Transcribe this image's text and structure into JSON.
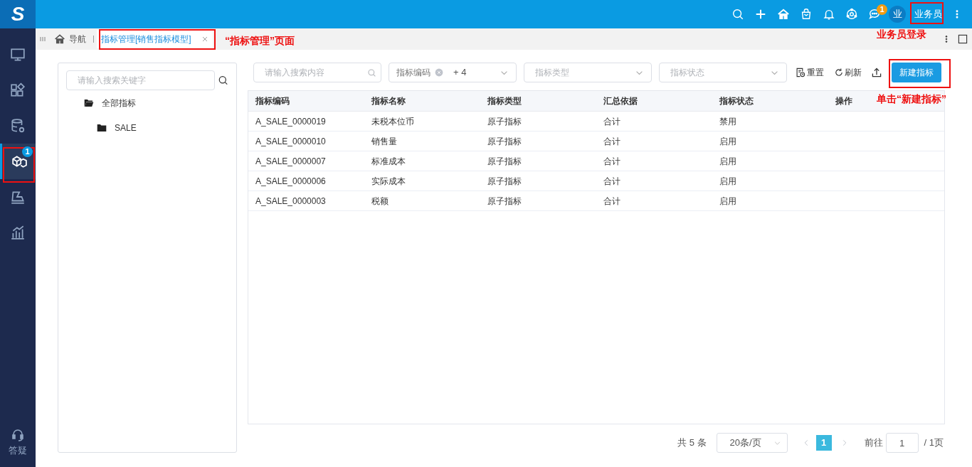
{
  "header": {
    "logo": "S",
    "notification_badge": "1",
    "avatar": "业",
    "user": "业务员"
  },
  "tabs": [
    {
      "kind": "home",
      "label": "导航",
      "selected": false
    },
    {
      "kind": "page",
      "label": "指标管理[销售指标模型]",
      "selected": true
    }
  ],
  "sidebar": {
    "items": [
      {
        "selected": false
      },
      {
        "selected": false
      },
      {
        "selected": false
      },
      {
        "selected": true,
        "badge": "1"
      },
      {
        "selected": false
      },
      {
        "selected": false
      }
    ],
    "help": "答疑"
  },
  "tree": {
    "placeholder": "请输入搜索关键字",
    "nodes": [
      {
        "label": "全部指标",
        "expanded": true,
        "children": [
          {
            "label": "SALE"
          }
        ]
      }
    ]
  },
  "filters": {
    "search_placeholder": "请输入搜索内容",
    "code_tag": "指标编码",
    "code_more": "+ 4",
    "type_placeholder": "指标类型",
    "status_placeholder": "指标状态"
  },
  "toolbar": [
    {
      "kind": "reset",
      "label": "重置"
    },
    {
      "kind": "refresh",
      "label": "刷新"
    },
    {
      "kind": "upload"
    },
    {
      "kind": "primary",
      "label": "新建指标"
    }
  ],
  "table": {
    "columns": [
      "指标编码",
      "指标名称",
      "指标类型",
      "汇总依据",
      "指标状态",
      "操作"
    ],
    "rows": [
      [
        "A_SALE_0000019",
        "未税本位币",
        "原子指标",
        "合计",
        "禁用"
      ],
      [
        "A_SALE_0000010",
        "销售量",
        "原子指标",
        "合计",
        "启用"
      ],
      [
        "A_SALE_0000007",
        "标准成本",
        "原子指标",
        "合计",
        "启用"
      ],
      [
        "A_SALE_0000006",
        "实际成本",
        "原子指标",
        "合计",
        "启用"
      ],
      [
        "A_SALE_0000003",
        "税额",
        "原子指标",
        "合计",
        "启用"
      ]
    ]
  },
  "pagination": {
    "total": "共 5 条",
    "page_size": "20条/页",
    "pages": [
      {
        "label": "1",
        "selected": true
      }
    ],
    "goto_label": "前往",
    "goto_value": "1",
    "page_count": "/ 1页"
  },
  "annotations": [
    {
      "text": "“指标管理”页面"
    },
    {
      "text": "业务员登录"
    },
    {
      "text": "单击“新建指标”"
    }
  ]
}
